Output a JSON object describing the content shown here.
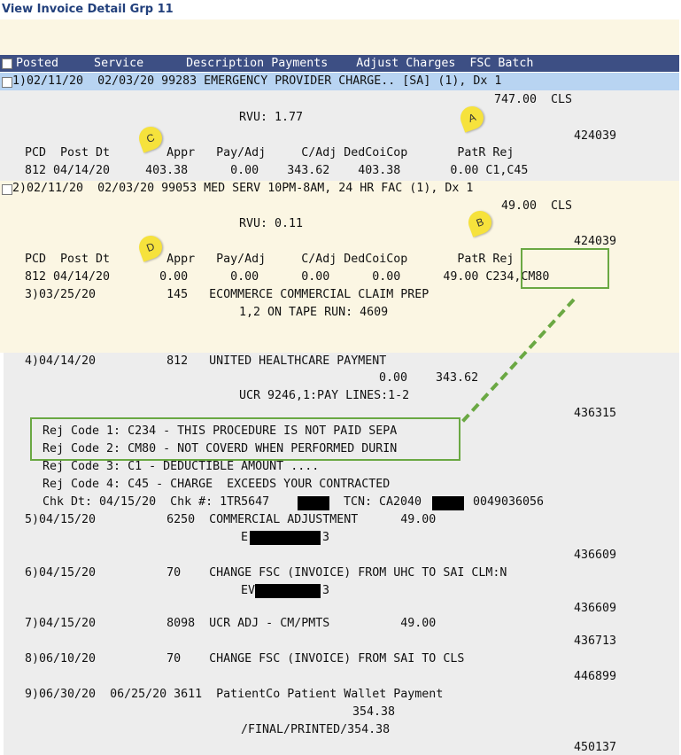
{
  "title": "View Invoice Detail Grp 11",
  "header": {
    "labels": "Posted     Service      Description Payments    Adjust Charges  FSC Batch"
  },
  "rows": [
    {
      "line": "1)02/11/20  02/03/20 99283 EMERGENCY PROVIDER CHARGE.. [SA] (1), Dx 1",
      "amount": "747.00  CLS",
      "rvu": "RVU: 1.77",
      "batch": "424039",
      "pcd_header": "PCD  Post Dt        Appr   Pay/Adj     C/Adj DedCoiCop       PatR Rej",
      "pcd_values": "812 04/14/20     403.38      0.00    343.62    403.38       0.00 C1,C45"
    },
    {
      "line": "2)02/11/20  02/03/20 99053 MED SERV 10PM-8AM, 24 HR FAC (1), Dx 1",
      "amount": "49.00  CLS",
      "rvu": "RVU: 0.11",
      "batch": "424039",
      "pcd_header": "PCD  Post Dt        Appr   Pay/Adj     C/Adj DedCoiCop       PatR Rej",
      "pcd_values": "812 04/14/20       0.00      0.00      0.00      0.00      49.00 C234,CM80"
    },
    {
      "line": "3)03/25/20          145   ECOMMERCE COMMERCIAL CLAIM PREP",
      "sub": "1,2 ON TAPE RUN: 4609"
    },
    {
      "line": "4)04/14/20          812   UNITED HEALTHCARE PAYMENT",
      "amounts": "0.00    343.62",
      "ucr": "UCR 9246,1:PAY LINES:1-2",
      "batch": "436315",
      "rej_codes": [
        "Rej Code 1: C234 - THIS PROCEDURE IS NOT PAID SEPA",
        "Rej Code 2: CM80 - NOT COVERD WHEN PERFORMED DURIN",
        "Rej Code 3: C1 - DEDUCTIBLE AMOUNT ....",
        "Rej Code 4: C45 - CHARGE  EXCEEDS YOUR CONTRACTED"
      ],
      "chk_dt": "Chk Dt: 04/15/20  Chk #: 1TR5647",
      "tcn_label": "TCN: CA2040",
      "tcn_tail": "0049036056"
    },
    {
      "line": "5)04/15/20          6250  COMMERCIAL ADJUSTMENT      49.00",
      "sub_a": "E",
      "sub_b": "3",
      "batch": "436609"
    },
    {
      "line": "6)04/15/20          70    CHANGE FSC (INVOICE) FROM UHC TO SAI CLM:N",
      "sub_a": "EV",
      "sub_b": "3",
      "batch": "436609"
    },
    {
      "line": "7)04/15/20          8098  UCR ADJ - CM/PMTS          49.00",
      "batch": "436713"
    },
    {
      "line": "8)06/10/20          70    CHANGE FSC (INVOICE) FROM SAI TO CLS",
      "batch": "446899"
    },
    {
      "line": "9)06/30/20  06/25/20 3611  PatientCo Patient Wallet Payment",
      "amount": "354.38",
      "sub": "/FINAL/PRINTED/354.38",
      "batch": "450137"
    }
  ],
  "callouts": {
    "a": "A",
    "b": "B",
    "c": "C",
    "d": "D"
  },
  "colors": {
    "header": "#3d4f84",
    "selected": "#b8d4f2",
    "cream": "#fbf6e3",
    "grey": "#ededed",
    "green": "#6aa843",
    "callout": "#f6e23c"
  }
}
